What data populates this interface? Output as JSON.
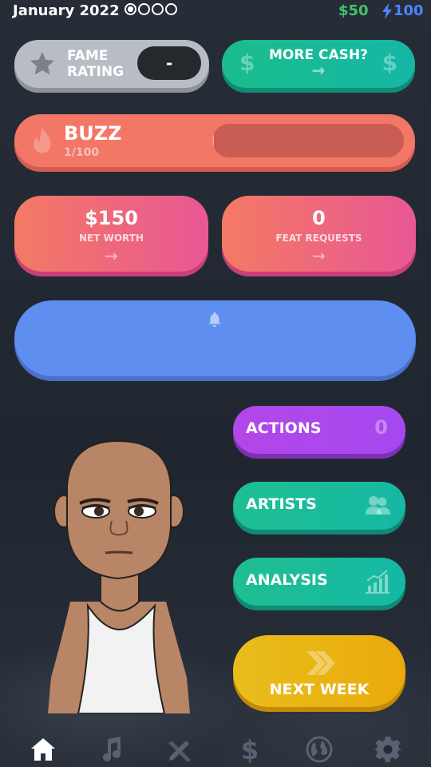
{
  "topbar": {
    "date": "January 2022",
    "week_dots_filled": 1,
    "week_dots_total": 4,
    "cash": "$50",
    "energy": "100"
  },
  "fame": {
    "label_line1": "FAME",
    "label_line2": "RATING",
    "value": "-",
    "icon": "star-icon"
  },
  "more_cash": {
    "label": "MORE CASH?",
    "currency_symbol": "$",
    "icon": "arrow-right-icon"
  },
  "buzz": {
    "title": "BUZZ",
    "progress_text": "1/100",
    "progress_fraction": 0.01,
    "icon": "flame-icon"
  },
  "net_worth": {
    "value": "$150",
    "label": "NET WORTH",
    "icon": "arrow-right-icon"
  },
  "feat_requests": {
    "value": "0",
    "label": "FEAT REQUESTS",
    "icon": "arrow-right-icon"
  },
  "notifications": {
    "icon": "bell-icon"
  },
  "actions": {
    "label": "ACTIONS",
    "count": "0"
  },
  "artists": {
    "label": "ARTISTS",
    "icon": "people-icon"
  },
  "analysis": {
    "label": "ANALYSIS",
    "icon": "bar-chart-icon"
  },
  "next_week": {
    "label": "NEXT WEEK",
    "icon": "double-chevron-icon"
  },
  "tabs": [
    {
      "name": "home",
      "icon": "home-icon",
      "active": true
    },
    {
      "name": "music",
      "icon": "music-note-icon",
      "active": false
    },
    {
      "name": "tools",
      "icon": "pencil-ruler-icon",
      "active": false
    },
    {
      "name": "money",
      "icon": "dollar-icon",
      "active": false
    },
    {
      "name": "world",
      "icon": "globe-icon",
      "active": false
    },
    {
      "name": "settings",
      "icon": "gear-icon",
      "active": false
    }
  ],
  "colors": {
    "cash": "#44c26c",
    "energy": "#4a86ff",
    "tab_active": "#ffffff",
    "tab_inactive": "#5b6170"
  }
}
